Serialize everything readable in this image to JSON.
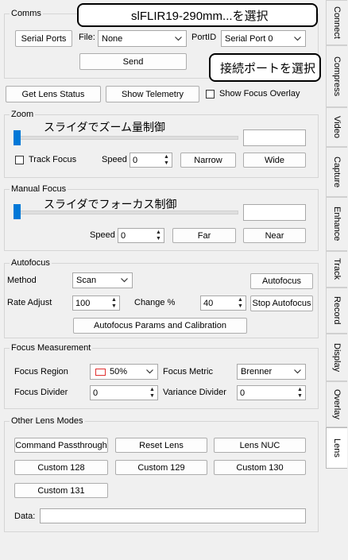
{
  "comms": {
    "title": "Comms",
    "serial_ports_button": "Serial Ports",
    "file_label": "File:",
    "file_value": "None",
    "portid_label": "PortID",
    "portid_value": "Serial Port 0",
    "send_button": "Send"
  },
  "callouts": {
    "select_file": "slFLIR19-290mm...を選択",
    "select_port": "接続ポートを選択",
    "zoom_slider": "スライダでズーム量制御",
    "focus_slider": "スライダでフォーカス制御"
  },
  "toolbar": {
    "get_lens_status": "Get Lens Status",
    "show_telemetry": "Show Telemetry",
    "show_focus_overlay": "Show Focus Overlay"
  },
  "zoom": {
    "title": "Zoom",
    "track_focus": "Track Focus",
    "speed_label": "Speed",
    "speed_value": "0",
    "narrow_button": "Narrow",
    "wide_button": "Wide",
    "value": ""
  },
  "manual_focus": {
    "title": "Manual Focus",
    "speed_label": "Speed",
    "speed_value": "0",
    "far_button": "Far",
    "near_button": "Near",
    "value": ""
  },
  "autofocus": {
    "title": "Autofocus",
    "method_label": "Method",
    "method_value": "Scan",
    "autofocus_button": "Autofocus",
    "rate_adjust_label": "Rate Adjust",
    "rate_adjust_value": "100",
    "change_label": "Change %",
    "change_value": "40",
    "stop_button": "Stop Autofocus",
    "params_button": "Autofocus Params and Calibration"
  },
  "focus_measurement": {
    "title": "Focus Measurement",
    "region_label": "Focus Region",
    "region_value": "50%",
    "metric_label": "Focus Metric",
    "metric_value": "Brenner",
    "divider_label": "Focus Divider",
    "divider_value": "0",
    "variance_label": "Variance Divider",
    "variance_value": "0"
  },
  "other_modes": {
    "title": "Other Lens Modes",
    "command_passthrough": "Command Passthrough",
    "reset_lens": "Reset Lens",
    "lens_nuc": "Lens NUC",
    "custom128": "Custom 128",
    "custom129": "Custom 129",
    "custom130": "Custom 130",
    "custom131": "Custom 131",
    "data_label": "Data:",
    "data_value": ""
  },
  "tabs": [
    "Connect",
    "Compress",
    "Video",
    "Capture",
    "Enhance",
    "Track",
    "Record",
    "Display",
    "Overlay",
    "Lens"
  ],
  "active_tab": "Lens",
  "colors": {
    "accent": "#0078d7",
    "region_swatch": "#e03030"
  }
}
